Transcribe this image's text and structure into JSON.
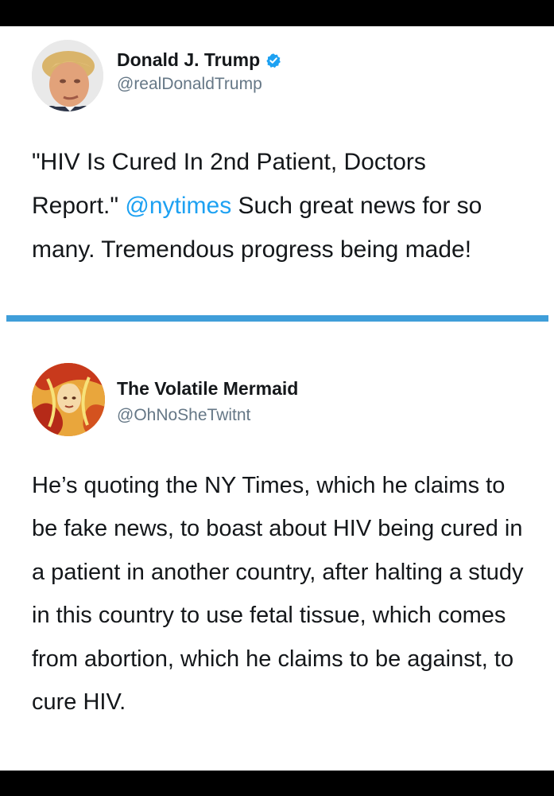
{
  "tweets": [
    {
      "display_name": "Donald J. Trump",
      "handle": "@realDonaldTrump",
      "verified": true,
      "avatar_icon": "profile-photo",
      "text_before": "\"HIV Is Cured In 2nd Patient, Doctors Report.\" ",
      "mention": "@nytimes",
      "text_after": "  Such great news for so many. Tremendous progress being made!"
    },
    {
      "display_name": "The Volatile Mermaid",
      "handle": "@OhNoSheTwitnt",
      "verified": false,
      "avatar_icon": "profile-photo",
      "text": "He’s quoting the NY Times, which he claims to be fake news, to boast about HIV being cured in a patient in another country, after halting a study in this country to use fetal tissue, which comes from abortion, which he claims to be against, to cure HIV."
    }
  ],
  "colors": {
    "mention": "#1da1f2",
    "divider": "#3f9ed9",
    "verified": "#1da1f2"
  }
}
